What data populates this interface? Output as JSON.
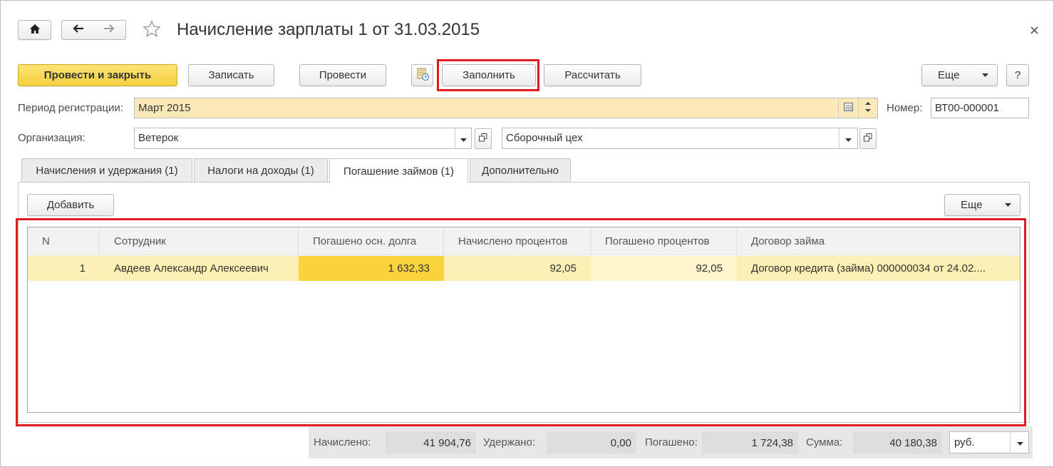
{
  "window": {
    "title": "Начисление зарплаты 1 от 31.03.2015"
  },
  "toolbar": {
    "post_and_close": "Провести и закрыть",
    "save": "Записать",
    "post": "Провести",
    "fill": "Заполнить",
    "calculate": "Рассчитать",
    "more": "Еще",
    "help": "?"
  },
  "header_fields": {
    "period_label": "Период регистрации:",
    "period_value": "Март 2015",
    "number_label": "Номер:",
    "number_value": "ВТ00-000001",
    "organization_label": "Организация:",
    "organization_value": "Ветерок",
    "department_value": "Сборочный цех"
  },
  "tabs": [
    {
      "label": "Начисления и удержания (1)",
      "active": false
    },
    {
      "label": "Налоги на доходы (1)",
      "active": false
    },
    {
      "label": "Погашение займов (1)",
      "active": true
    },
    {
      "label": "Дополнительно",
      "active": false
    }
  ],
  "table_toolbar": {
    "add": "Добавить",
    "more": "Еще"
  },
  "table": {
    "columns": [
      "N",
      "Сотрудник",
      "Погашено осн. долга",
      "Начислено процентов",
      "Погашено процентов",
      "Договор займа"
    ],
    "rows": [
      {
        "n": "1",
        "employee": "Авдеев Александр Алексеевич",
        "principal_repaid": "1 632,33",
        "interest_accrued": "92,05",
        "interest_repaid": "92,05",
        "loan_agreement": "Договор кредита (займа) 000000034 от 24.02....",
        "selected": true
      }
    ]
  },
  "totals": {
    "accrued_label": "Начислено:",
    "accrued_value": "41 904,76",
    "withheld_label": "Удержано:",
    "withheld_value": "0,00",
    "repaid_label": "Погашено:",
    "repaid_value": "1 724,38",
    "sum_label": "Сумма:",
    "sum_value": "40 180,38",
    "currency": "руб."
  },
  "icons": {
    "home": "home-icon",
    "back": "arrow-left-icon",
    "forward": "arrow-right-icon",
    "favorite": "star-icon",
    "close": "close-icon",
    "fill_history": "document-history-icon",
    "calendar": "calendar-icon",
    "spin": "spin-up-down-icon",
    "dropdown": "chevron-down-icon",
    "open": "open-form-icon"
  },
  "colors": {
    "primary_button": "#f5d040",
    "period_field_bg": "#fbe9b7",
    "selected_row_bg": "#fcf0b4",
    "active_cell_bg": "#f8d33c",
    "editable_cell_bg": "#fdf5cb",
    "highlight_frame": "#e21c1c",
    "totals_bar_bg": "#e7e7e7",
    "totals_value_bg": "#dedede"
  }
}
